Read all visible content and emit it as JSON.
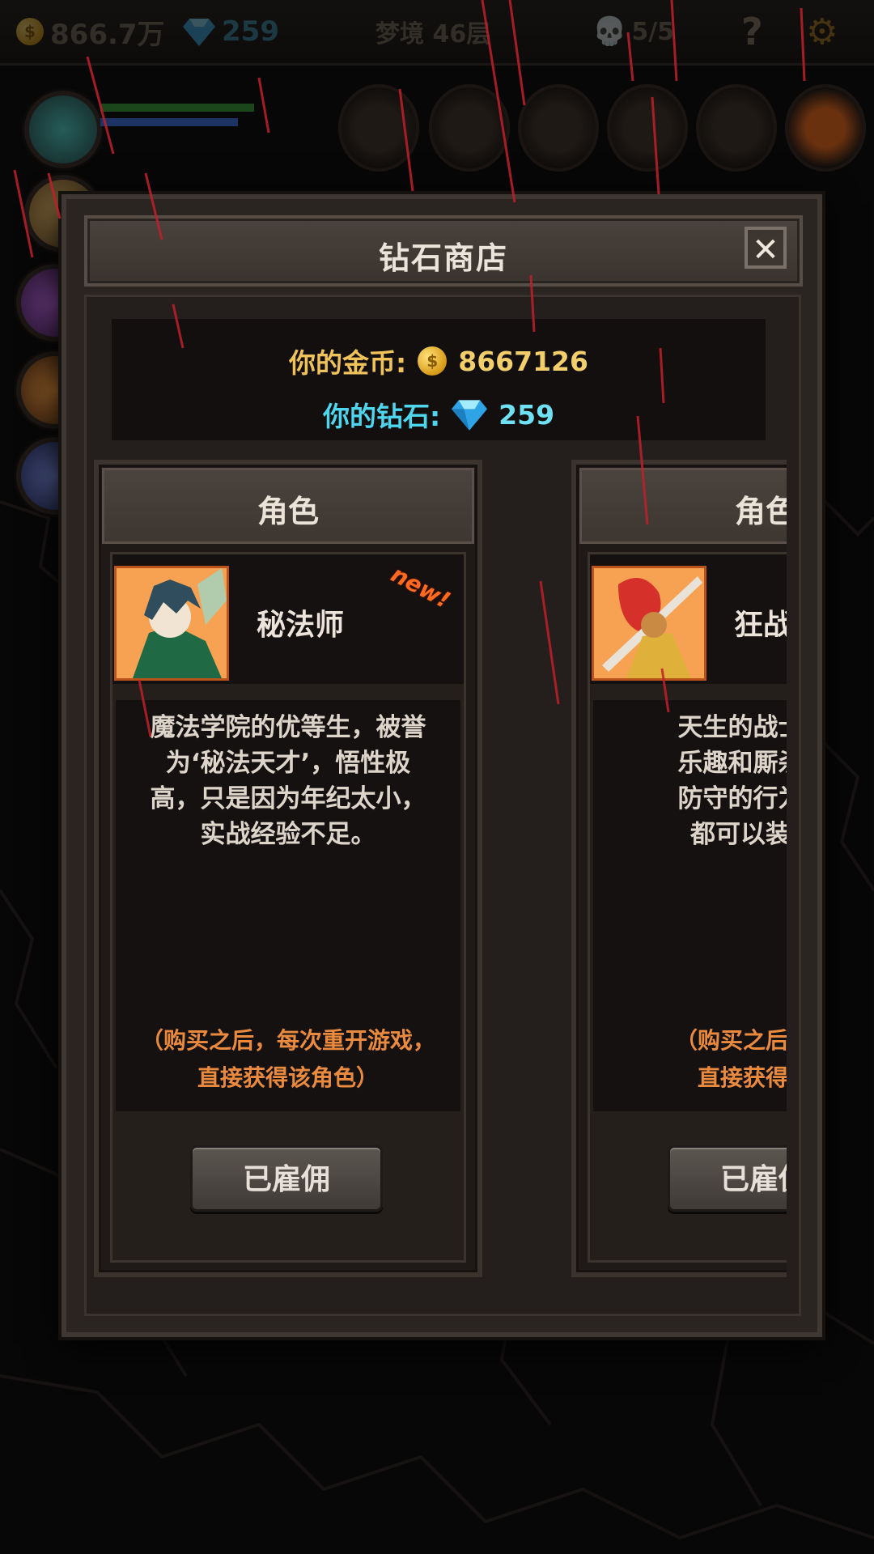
{
  "hud": {
    "gold": "866.7万",
    "diamonds": "259",
    "level": "梦境 46层",
    "skulls": "5/5",
    "help_icon": "question-mark-icon",
    "settings_icon": "gear-icon"
  },
  "dialog": {
    "title": "钻石商店",
    "close_icon": "close-icon",
    "gold_label": "你的金币:",
    "gold_value": "8667126",
    "diamond_label": "你的钻石:",
    "diamond_value": "259"
  },
  "cards": [
    {
      "header": "角色",
      "name": "秘法师",
      "badge": "new!",
      "desc_lines": [
        "魔法学院的优等生，被誉",
        "为‘秘法天才’，悟性极",
        "高，只是因为年纪太小，",
        "实战经验不足。"
      ],
      "note_lines": [
        "（购买之后，每次重开游戏，",
        "直接获得该角色）"
      ],
      "button": "已雇佣"
    },
    {
      "header": "角色",
      "name": "狂战士",
      "badge": "",
      "desc_lines": [
        "天生的战士，享",
        "乐趣和厮杀的快",
        "防守的行为，所",
        "都可以装备武"
      ],
      "note_lines": [
        "（购买之后，每次",
        "直接获得该角"
      ],
      "button": "已雇佣"
    }
  ],
  "colors": {
    "gold_text": "#f0c35a",
    "diamond_text": "#4ed6ef",
    "note_text": "#ea8a3e",
    "badge": "#ff6a1f"
  }
}
